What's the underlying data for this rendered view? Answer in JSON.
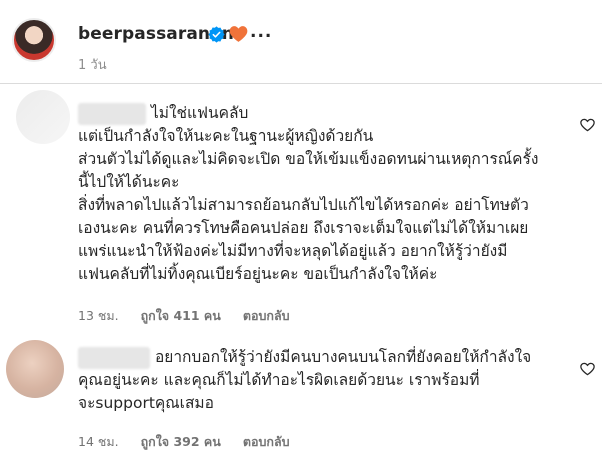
{
  "post": {
    "username": "beerpassaranan",
    "more_label": "...",
    "time": "1 วัน"
  },
  "comments": [
    {
      "lines": [
        "ไม่ใช่แฟนคลับ",
        "แต่เป็นกำลังใจให้นะคะในฐานะผู้หญิงด้วยกัน",
        "ส่วนตัวไม่ได้ดูและไม่คิดจะเปิด ขอให้เข้มแข็งอดทนผ่านเหตุการณ์ครั้ง",
        "นี้ไปให้ได้นะคะ",
        "สิ่งที่พลาดไปแล้วไม่สามารถย้อนกลับไปแก้ไขได้หรอกค่ะ อย่าโทษตัว",
        "เองนะคะ คนที่ควรโทษคือคนปล่อย ถึงเราจะเต็มใจแต่ไม่ได้ให้มาเผย",
        "แพร่แนะนำให้ฟ้องค่ะไม่มีทางที่จะหลุดได้อยู่แล้ว อยากให้รู้ว่ายังมี",
        "แฟนคลับที่ไม่ทิ้งคุณเบียร์อยู่นะคะ ขอเป็นกำลังใจให้ค่ะ"
      ],
      "time": "13 ชม.",
      "likes": "ถูกใจ 411 คน",
      "reply": "ตอบกลับ"
    },
    {
      "lines": [
        "อยากบอกให้รู้ว่ายังมีคนบางคนบนโลกที่ยังคอยให้กำลังใจ",
        "คุณอยู่นะคะ และคุณก็ไม่ได้ทำอะไรผิดเลยด้วยนะ เราพร้อมที่",
        "จะsupportคุณเสมอ"
      ],
      "time": "14 ชม.",
      "likes": "ถูกใจ 392 คน",
      "reply": "ตอบกลับ"
    }
  ],
  "colors": {
    "verified": "#0095f6",
    "heart": "#f0733a",
    "muted": "#737373"
  },
  "icons": {
    "verified": "verified-badge-icon",
    "heart": "orange-heart-icon",
    "like": "heart-outline-icon"
  }
}
